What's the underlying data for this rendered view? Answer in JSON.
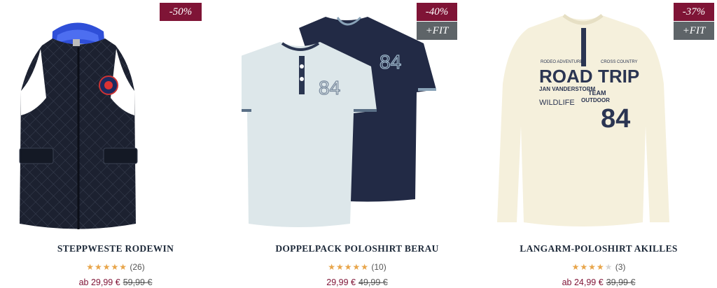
{
  "products": [
    {
      "title": "STEPPWESTE RODEWIN",
      "discount": "-50%",
      "fit": "",
      "stars_full": "★★★★★",
      "stars_empty": "",
      "reviews": "(26)",
      "price": "ab 29,99 €",
      "old_price": "59,99 €"
    },
    {
      "title": "DOPPELPACK POLOSHIRT BERAU",
      "discount": "-40%",
      "fit": "+FIT",
      "stars_full": "★★★★★",
      "stars_empty": "",
      "reviews": "(10)",
      "price": "29,99 €",
      "old_price": "49,99 €"
    },
    {
      "title": "LANGARM-POLOSHIRT AKILLES",
      "discount": "-37%",
      "fit": "+FIT",
      "stars_full": "★★★★",
      "stars_empty": "★",
      "reviews": "(3)",
      "price": "ab 24,99 €",
      "old_price": "39,99 €"
    }
  ],
  "graphics": {
    "polo_number": "84",
    "print_road": "ROAD",
    "print_trip": "TRIP",
    "print_brand": "JAN VANDERSTORM",
    "print_wildlife": "WILDLIFE",
    "print_team": "TEAM",
    "print_outdoor": "OUTDOOR",
    "print_rodeo": "RODEO ADVENTURE",
    "print_cross": "CROSS COUNTRY"
  },
  "colors": {
    "sale_badge": "#7f1436",
    "fit_badge": "#5e6468",
    "star": "#e8a54a",
    "price": "#7f1436"
  }
}
